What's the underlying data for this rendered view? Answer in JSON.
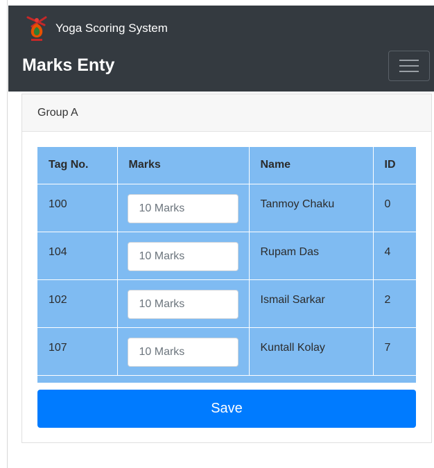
{
  "header": {
    "brand_name": "Yoga Scoring System",
    "page_title": "Marks Enty",
    "logo_icon": "yoga-figure-logo-icon",
    "menu_icon": "hamburger-menu-icon",
    "navbar_color": "#343a40"
  },
  "card": {
    "group_label": "Group A"
  },
  "table": {
    "columns": [
      "Tag No.",
      "Marks",
      "Name",
      "ID"
    ],
    "rows": [
      {
        "tag": "100",
        "marks_placeholder": "10 Marks",
        "name": "Tanmoy Chaku",
        "id": "0"
      },
      {
        "tag": "104",
        "marks_placeholder": "10 Marks",
        "name": "Rupam Das",
        "id": "4"
      },
      {
        "tag": "102",
        "marks_placeholder": "10 Marks",
        "name": "Ismail Sarkar",
        "id": "2"
      },
      {
        "tag": "107",
        "marks_placeholder": "10 Marks",
        "name": "Kuntall Kolay",
        "id": "7"
      }
    ],
    "background_color": "#7fbbf2"
  },
  "actions": {
    "save_label": "Save",
    "save_color": "#007bff"
  }
}
